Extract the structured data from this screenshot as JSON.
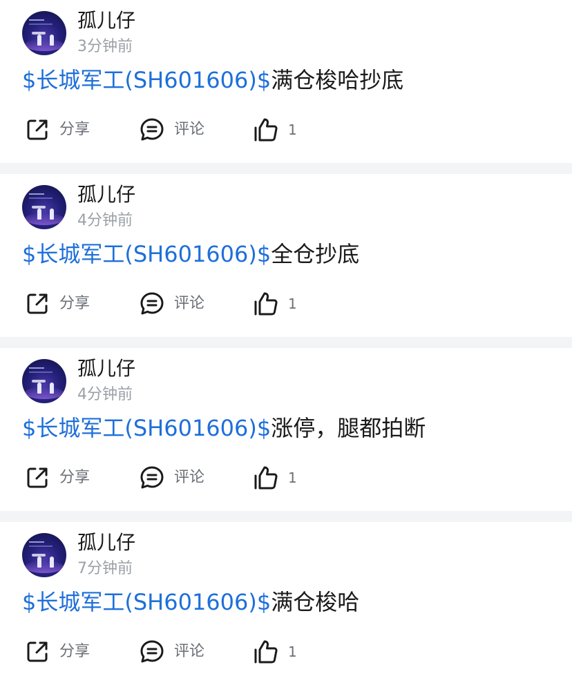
{
  "feed": {
    "posts": [
      {
        "username": "孤儿仔",
        "time": "3分钟前",
        "stock_link": "$长城军工(SH601606)$",
        "text": "满仓梭哈抄底",
        "share_label": "分享",
        "comment_label": "评论",
        "like_count": "1"
      },
      {
        "username": "孤儿仔",
        "time": "4分钟前",
        "stock_link": "$长城军工(SH601606)$",
        "text": "全仓抄底",
        "share_label": "分享",
        "comment_label": "评论",
        "like_count": "1"
      },
      {
        "username": "孤儿仔",
        "time": "4分钟前",
        "stock_link": "$长城军工(SH601606)$",
        "text": "涨停，腿都拍断",
        "share_label": "分享",
        "comment_label": "评论",
        "like_count": "1"
      },
      {
        "username": "孤儿仔",
        "time": "7分钟前",
        "stock_link": "$长城军工(SH601606)$",
        "text": "满仓梭哈",
        "share_label": "分享",
        "comment_label": "评论",
        "like_count": "1"
      }
    ]
  },
  "icons": {
    "share": "share-icon",
    "comment": "comment-icon",
    "like": "thumbs-up-icon"
  },
  "colors": {
    "link": "#1e6fd9",
    "text": "#1a1a1a",
    "muted": "#9aa0a6",
    "action_label": "#6b6f75",
    "separator": "#f3f4f6"
  }
}
